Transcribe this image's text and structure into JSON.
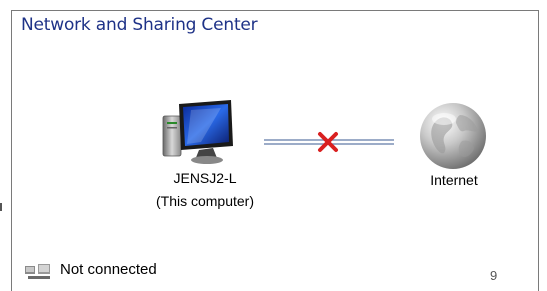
{
  "window": {
    "title": "Network and Sharing Center"
  },
  "map": {
    "computer": {
      "icon": "computer-monitor-icon",
      "name": "JENSJ2-L",
      "subtitle": "(This computer)"
    },
    "link": {
      "status_icon": "red-x-icon",
      "status_color": "#d92020"
    },
    "internet": {
      "icon": "globe-icon",
      "label": "Internet"
    }
  },
  "status_bar": {
    "icon": "network-disconnected-icon",
    "text": "Not connected",
    "page_number": "9"
  },
  "colors": {
    "title": "#1e3287",
    "border": "#7a7a7a",
    "link_line": "#7b90b5",
    "x_mark": "#d92020"
  }
}
